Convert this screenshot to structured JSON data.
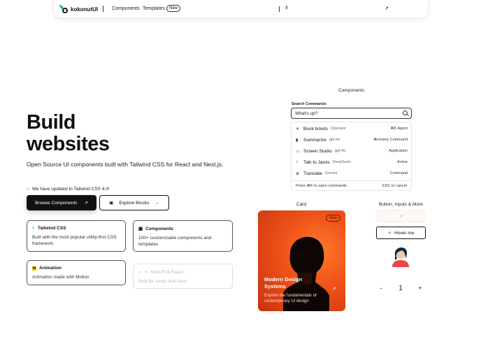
{
  "nav": {
    "brand": "kokonutUI",
    "components": "Components",
    "templates": "Templates",
    "new_badge": "New",
    "icons": [
      "tailwind-icon",
      "external-link-icon"
    ]
  },
  "hero": {
    "title_line1": "Build",
    "title_line2": "websites",
    "subtitle": "Open Source UI components built with Tailwind CSS for React and Next.js.",
    "update": "We have updated to Tailwind CSS 4.0!",
    "browse": "Browse Components",
    "explore": "Explore Blocks"
  },
  "features": [
    {
      "title": "Tailwind CSS",
      "desc": "Built with the most popular utility-first CSS framework"
    },
    {
      "title": "Components",
      "desc": "100+ customizable components and templates"
    },
    {
      "title": "Animation",
      "desc": "Animation made with Motion"
    },
    {
      "title": "NextJS & React",
      "desc": "Built for nextjs and react"
    }
  ],
  "sections": {
    "components": "Components",
    "card": "Card",
    "buttons": "Button, Inputs & More"
  },
  "command": {
    "label": "Search Commands",
    "search_value": "What's up?",
    "items": [
      {
        "icon": "plane",
        "name": "Book tickets",
        "sub": "Operator",
        "right": "⌘K Agent"
      },
      {
        "icon": "chart",
        "name": "Summarize",
        "sub": "gpt-4o",
        "right": "⌘cmd+p Command"
      },
      {
        "icon": "layers",
        "name": "Screen Studio",
        "sub": "gpt-4o",
        "right": "Application"
      },
      {
        "icon": "audio",
        "name": "Talk to Jarvis",
        "sub": "DeepSeek",
        "right": "Active"
      },
      {
        "icon": "globe",
        "name": "Translate",
        "sub": "Gemini",
        "right": "Command"
      }
    ],
    "footer_left": "Press ⌘K to open commands",
    "footer_right": "ESC to cancel"
  },
  "promo": {
    "badge": "New",
    "title": "Modern Design Systems",
    "desc": "Explore the fundamentals of contemporary UI design"
  },
  "controls": {
    "hover": "Hover me",
    "stepper_value": "1",
    "minus": "-",
    "plus": "+"
  },
  "colors": {
    "accent_orange": "#f0541a",
    "tailwind_blue": "#38bdf8",
    "dark": "#111111"
  }
}
